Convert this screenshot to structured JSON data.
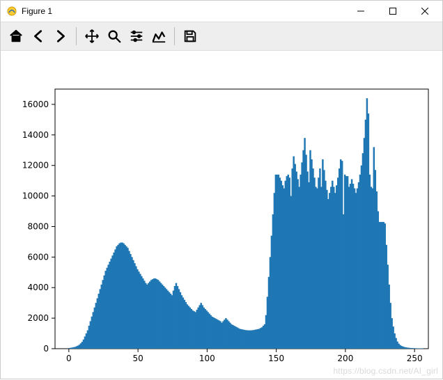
{
  "window": {
    "title": "Figure 1",
    "buttons": {
      "minimize": "Minimize",
      "maximize": "Maximize",
      "close": "Close"
    }
  },
  "toolbar": {
    "home": "Home",
    "back": "Back",
    "forward": "Forward",
    "pan": "Pan",
    "zoom": "Zoom",
    "configure": "Configure subplots",
    "edit": "Edit axis/curve",
    "save": "Save"
  },
  "watermark": "https://blog.csdn.net/AI_girl",
  "chart_data": {
    "type": "bar",
    "title": "",
    "xlabel": "",
    "ylabel": "",
    "xlim": [
      -10,
      260
    ],
    "ylim": [
      0,
      17000
    ],
    "xticks": [
      0,
      50,
      100,
      150,
      200,
      250
    ],
    "yticks": [
      0,
      2000,
      4000,
      6000,
      8000,
      10000,
      12000,
      14000,
      16000
    ],
    "color": "#1f77b4",
    "categories": [
      0,
      1,
      2,
      3,
      4,
      5,
      6,
      7,
      8,
      9,
      10,
      11,
      12,
      13,
      14,
      15,
      16,
      17,
      18,
      19,
      20,
      21,
      22,
      23,
      24,
      25,
      26,
      27,
      28,
      29,
      30,
      31,
      32,
      33,
      34,
      35,
      36,
      37,
      38,
      39,
      40,
      41,
      42,
      43,
      44,
      45,
      46,
      47,
      48,
      49,
      50,
      51,
      52,
      53,
      54,
      55,
      56,
      57,
      58,
      59,
      60,
      61,
      62,
      63,
      64,
      65,
      66,
      67,
      68,
      69,
      70,
      71,
      72,
      73,
      74,
      75,
      76,
      77,
      78,
      79,
      80,
      81,
      82,
      83,
      84,
      85,
      86,
      87,
      88,
      89,
      90,
      91,
      92,
      93,
      94,
      95,
      96,
      97,
      98,
      99,
      100,
      101,
      102,
      103,
      104,
      105,
      106,
      107,
      108,
      109,
      110,
      111,
      112,
      113,
      114,
      115,
      116,
      117,
      118,
      119,
      120,
      121,
      122,
      123,
      124,
      125,
      126,
      127,
      128,
      129,
      130,
      131,
      132,
      133,
      134,
      135,
      136,
      137,
      138,
      139,
      140,
      141,
      142,
      143,
      144,
      145,
      146,
      147,
      148,
      149,
      150,
      151,
      152,
      153,
      154,
      155,
      156,
      157,
      158,
      159,
      160,
      161,
      162,
      163,
      164,
      165,
      166,
      167,
      168,
      169,
      170,
      171,
      172,
      173,
      174,
      175,
      176,
      177,
      178,
      179,
      180,
      181,
      182,
      183,
      184,
      185,
      186,
      187,
      188,
      189,
      190,
      191,
      192,
      193,
      194,
      195,
      196,
      197,
      198,
      199,
      200,
      201,
      202,
      203,
      204,
      205,
      206,
      207,
      208,
      209,
      210,
      211,
      212,
      213,
      214,
      215,
      216,
      217,
      218,
      219,
      220,
      221,
      222,
      223,
      224,
      225,
      226,
      227,
      228,
      229,
      230,
      231,
      232,
      233,
      234,
      235,
      236,
      237,
      238,
      239,
      240,
      241,
      242,
      243,
      244,
      245,
      246,
      247,
      248,
      249,
      250,
      251,
      252,
      253,
      254,
      255
    ],
    "values": [
      50,
      60,
      80,
      100,
      120,
      160,
      200,
      260,
      350,
      450,
      600,
      800,
      1000,
      1200,
      1500,
      1800,
      2100,
      2400,
      2700,
      3000,
      3300,
      3600,
      3900,
      4200,
      4500,
      4800,
      5100,
      5300,
      5500,
      5700,
      5900,
      6100,
      6300,
      6500,
      6700,
      6800,
      6900,
      6950,
      6950,
      6900,
      6800,
      6700,
      6600,
      6400,
      6200,
      6000,
      5800,
      5600,
      5400,
      5200,
      5050,
      4900,
      4750,
      4600,
      4450,
      4300,
      4200,
      4300,
      4400,
      4500,
      4550,
      4600,
      4600,
      4550,
      4500,
      4400,
      4300,
      4200,
      4100,
      4000,
      3900,
      3800,
      3700,
      3600,
      3500,
      3800,
      4100,
      4300,
      4100,
      3900,
      3700,
      3500,
      3350,
      3200,
      3050,
      2900,
      2800,
      2700,
      2600,
      2500,
      2450,
      2400,
      2550,
      2700,
      2850,
      3000,
      2850,
      2700,
      2600,
      2500,
      2400,
      2300,
      2200,
      2100,
      2050,
      2000,
      1950,
      1900,
      1850,
      1800,
      1700,
      1800,
      1900,
      2000,
      1900,
      1800,
      1700,
      1600,
      1550,
      1500,
      1450,
      1400,
      1350,
      1300,
      1280,
      1260,
      1240,
      1220,
      1210,
      1200,
      1200,
      1200,
      1210,
      1220,
      1240,
      1260,
      1280,
      1300,
      1350,
      1400,
      1500,
      1600,
      2200,
      3400,
      4700,
      6000,
      7400,
      8800,
      10200,
      11400,
      11400,
      11400,
      11200,
      11000,
      10700,
      10500,
      11000,
      11300,
      11400,
      11200,
      10000,
      11800,
      12600,
      12100,
      11600,
      11100,
      10600,
      11400,
      12200,
      13000,
      13800,
      12700,
      11600,
      10900,
      13000,
      12400,
      11800,
      11200,
      10600,
      10500,
      11200,
      11800,
      10600,
      12400,
      11700,
      11000,
      10400,
      9800,
      10200,
      10600,
      11000,
      10600,
      10200,
      10700,
      11200,
      11800,
      12400,
      12300,
      8800,
      11400,
      11300,
      11300,
      10600,
      10800,
      11100,
      10800,
      10500,
      10200,
      10500,
      10900,
      11400,
      12000,
      12800,
      13800,
      15000,
      16400,
      15400,
      11400,
      10600,
      10500,
      13200,
      11700,
      10300,
      9000,
      8300,
      8300,
      8300,
      8300,
      8200,
      6800,
      5500,
      4200,
      3000,
      2000,
      1450,
      1000,
      700,
      470,
      330,
      240,
      180,
      140,
      110,
      90,
      75,
      62,
      52,
      44,
      38,
      33,
      29,
      26,
      24,
      22,
      21,
      20
    ]
  }
}
